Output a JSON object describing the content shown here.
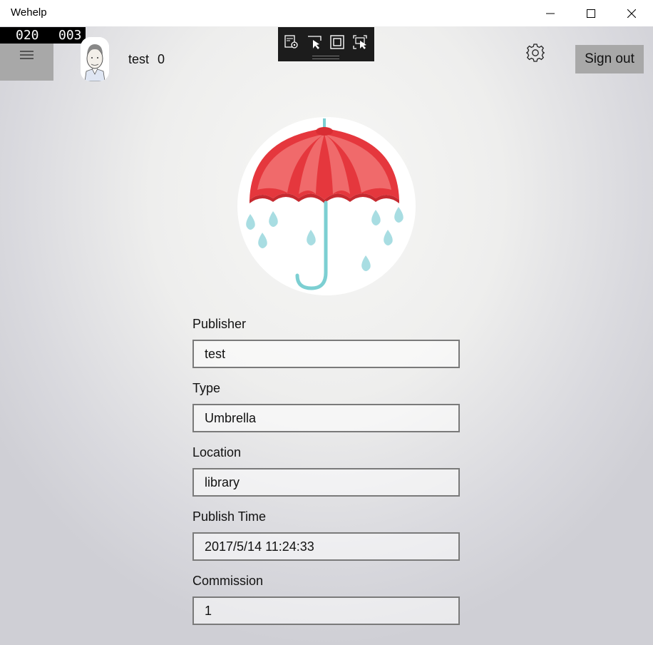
{
  "window": {
    "title": "Wehelp"
  },
  "counter": {
    "left": "020",
    "right": "003"
  },
  "user": {
    "name": "test",
    "count": "0"
  },
  "header": {
    "sign_out_label": "Sign out"
  },
  "icons": {
    "menu": "hamburger-icon",
    "settings": "gear-icon",
    "avatar": "avatar-icon",
    "hero": "umbrella-icon"
  },
  "colors": {
    "umbrella_red": "#e5373d",
    "rain_blue": "#a8dde2",
    "button_gray": "#a8a8a8",
    "field_border": "#7a7a7a"
  },
  "form": {
    "publisher": {
      "label": "Publisher",
      "value": "test"
    },
    "type": {
      "label": "Type",
      "value": "Umbrella"
    },
    "location": {
      "label": "Location",
      "value": "library"
    },
    "publish_time": {
      "label": "Publish Time",
      "value": "2017/5/14 11:24:33"
    },
    "commission": {
      "label": "Commission",
      "value": "1"
    }
  }
}
